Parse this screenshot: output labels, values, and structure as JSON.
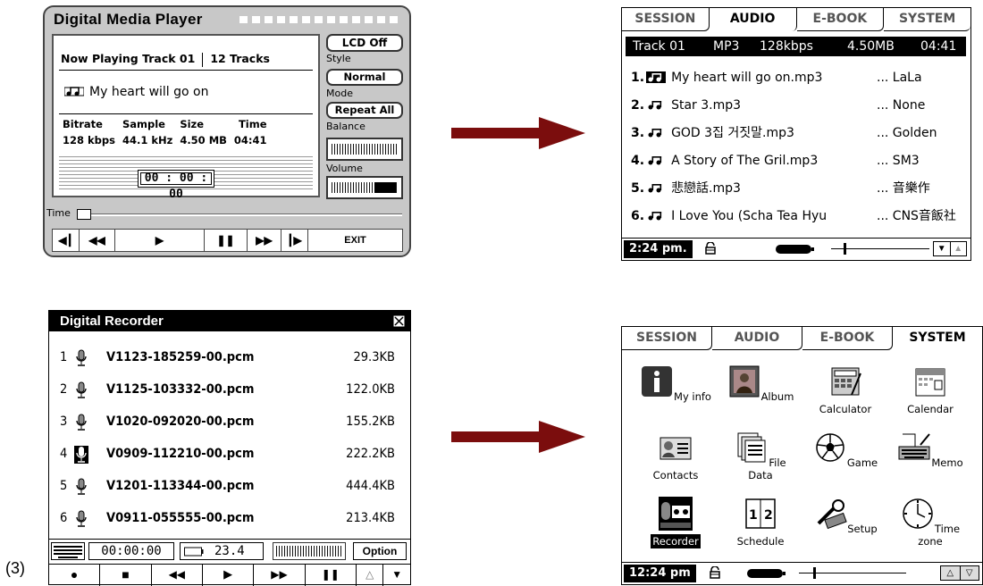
{
  "figure_label": "(3)",
  "media_player": {
    "title": "Digital Media Player",
    "now_playing": "Now Playing Track 01",
    "track_count": "12 Tracks",
    "song": "My heart will go on",
    "stat_headers": [
      "Bitrate",
      "Sample",
      "Size",
      "Time"
    ],
    "stat_values": [
      "128 kbps",
      "44.1 kHz",
      "4.50 MB",
      "04:41"
    ],
    "elapsed": "00 : 00 : 00",
    "lcd_button": "LCD Off",
    "style_label": "Style",
    "style_value": "Normal",
    "mode_label": "Mode",
    "mode_value": "Repeat All",
    "balance_label": "Balance",
    "volume_label": "Volume",
    "time_label": "Time",
    "exit_label": "EXIT"
  },
  "audio": {
    "tabs": [
      "SESSION",
      "AUDIO",
      "E-BOOK",
      "SYSTEM"
    ],
    "active_tab": "AUDIO",
    "header": {
      "track": "Track 01",
      "format": "MP3",
      "bitrate": "128kbps",
      "size": "4.50MB",
      "time": "04:41"
    },
    "tracks": [
      {
        "num": "1.",
        "name": "My heart will go on.mp3",
        "artist": "... LaLa"
      },
      {
        "num": "2.",
        "name": "Star 3.mp3",
        "artist": "... None"
      },
      {
        "num": "3.",
        "name": "GOD 3집 거짓말.mp3",
        "artist": "... Golden"
      },
      {
        "num": "4.",
        "name": "A Story of The Gril.mp3",
        "artist": "... SM3"
      },
      {
        "num": "5.",
        "name": "悲戀話.mp3",
        "artist": "... 音樂作"
      },
      {
        "num": "6.",
        "name": "I Love You (Scha Tea Hyu",
        "artist": "... CNS音飯社"
      }
    ],
    "status_time": "2:24 pm."
  },
  "recorder": {
    "title": "Digital Recorder",
    "files": [
      {
        "num": "1",
        "name": "V1123-185259-00.pcm",
        "size": "29.3KB"
      },
      {
        "num": "2",
        "name": "V1125-103332-00.pcm",
        "size": "122.0KB"
      },
      {
        "num": "3",
        "name": "V1020-092020-00.pcm",
        "size": "155.2KB"
      },
      {
        "num": "4",
        "name": "V0909-112210-00.pcm",
        "size": "222.2KB"
      },
      {
        "num": "5",
        "name": "V1201-113344-00.pcm",
        "size": "444.4KB"
      },
      {
        "num": "6",
        "name": "V0911-055555-00.pcm",
        "size": "213.4KB"
      }
    ],
    "elapsed": "00:00:00",
    "battery": "23.4",
    "option_label": "Option"
  },
  "system": {
    "tabs": [
      "SESSION",
      "AUDIO",
      "E-BOOK",
      "SYSTEM"
    ],
    "active_tab": "SYSTEM",
    "apps": [
      {
        "label": "My info",
        "icon": "info-icon"
      },
      {
        "label": "Album",
        "icon": "album-icon"
      },
      {
        "label": "Calculator",
        "icon": "calculator-icon"
      },
      {
        "label": "Calendar",
        "icon": "calendar-icon"
      },
      {
        "label": "Contacts",
        "icon": "contacts-icon"
      },
      {
        "label": "File Data",
        "icon": "file-data-icon"
      },
      {
        "label": "Game",
        "icon": "soccer-ball-icon"
      },
      {
        "label": "Memo",
        "icon": "keyboard-memo-icon"
      },
      {
        "label": "Recorder",
        "icon": "recorder-icon"
      },
      {
        "label": "Schedule",
        "icon": "schedule-icon"
      },
      {
        "label": "Setup",
        "icon": "setup-icon"
      },
      {
        "label": "Time zone",
        "icon": "clock-icon"
      }
    ],
    "selected_app": "Recorder",
    "status_time": "12:24 pm"
  },
  "colors": {
    "arrow": "#7b0d0d",
    "player_bg": "#c8c8c8",
    "highlight": "#000000"
  }
}
